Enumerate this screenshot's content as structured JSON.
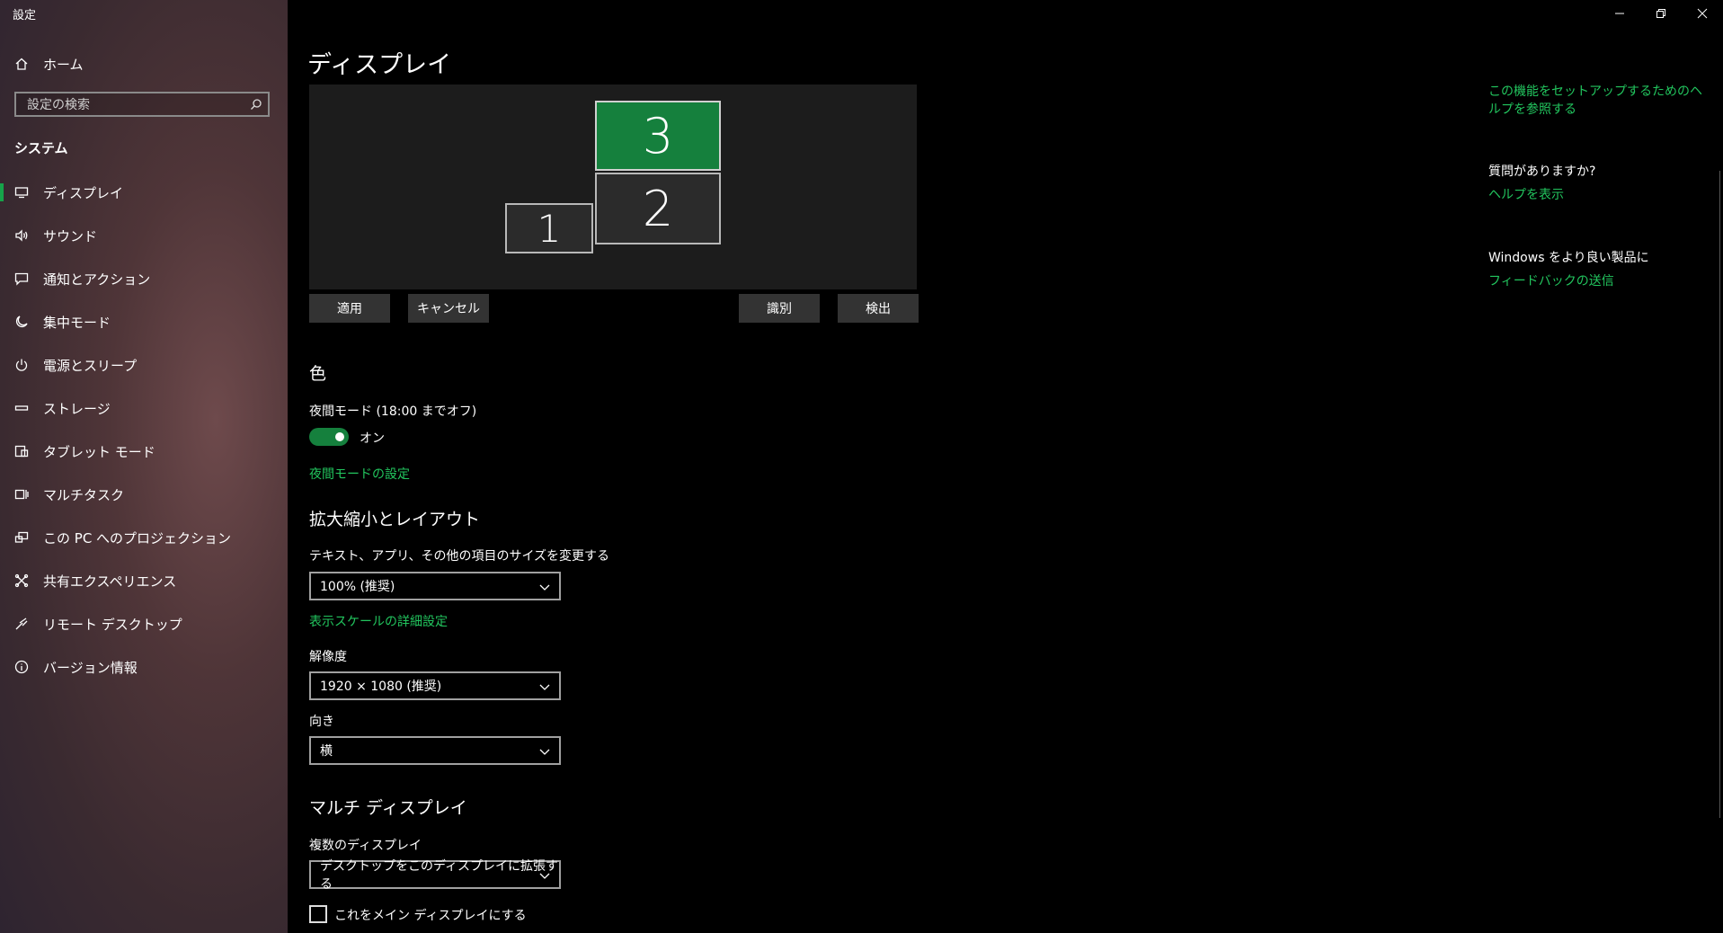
{
  "window": {
    "title": "設定"
  },
  "sidebar": {
    "home_label": "ホーム",
    "search_placeholder": "設定の検索",
    "section_heading": "システム",
    "items": [
      {
        "label": "ディスプレイ",
        "icon": "display-icon",
        "selected": true
      },
      {
        "label": "サウンド",
        "icon": "speaker-icon"
      },
      {
        "label": "通知とアクション",
        "icon": "notification-icon"
      },
      {
        "label": "集中モード",
        "icon": "moon-icon"
      },
      {
        "label": "電源とスリープ",
        "icon": "power-icon"
      },
      {
        "label": "ストレージ",
        "icon": "storage-icon"
      },
      {
        "label": "タブレット モード",
        "icon": "tablet-icon"
      },
      {
        "label": "マルチタスク",
        "icon": "multitask-icon"
      },
      {
        "label": "この PC へのプロジェクション",
        "icon": "projection-icon"
      },
      {
        "label": "共有エクスペリエンス",
        "icon": "share-icon"
      },
      {
        "label": "リモート デスクトップ",
        "icon": "remote-icon"
      },
      {
        "label": "バージョン情報",
        "icon": "info-icon"
      }
    ]
  },
  "main": {
    "title": "ディスプレイ",
    "monitors": [
      {
        "number": "1"
      },
      {
        "number": "2"
      },
      {
        "number": "3",
        "active": true
      }
    ],
    "buttons": {
      "apply": "適用",
      "cancel": "キャンセル",
      "identify": "識別",
      "detect": "検出"
    },
    "color": {
      "heading": "色",
      "night_mode_label": "夜間モード (18:00 までオフ)",
      "toggle_state": "オン",
      "night_settings_link": "夜間モードの設定"
    },
    "scale": {
      "heading": "拡大縮小とレイアウト",
      "size_label": "テキスト、アプリ、その他の項目のサイズを変更する",
      "size_value": "100% (推奨)",
      "advanced_link": "表示スケールの詳細設定",
      "resolution_label": "解像度",
      "resolution_value": "1920 × 1080 (推奨)",
      "orientation_label": "向き",
      "orientation_value": "横"
    },
    "multi": {
      "heading": "マルチ ディスプレイ",
      "multi_label": "複数のディスプレイ",
      "multi_value": "デスクトップをこのディスプレイに拡張する",
      "main_checkbox_label": "これをメイン ディスプレイにする"
    }
  },
  "help": {
    "setup_link": "この機能をセットアップするためのヘルプを参照する",
    "question_heading": "質問がありますか?",
    "help_link": "ヘルプを表示",
    "feedback_heading": "Windows をより良い製品に",
    "feedback_link": "フィードバックの送信"
  },
  "colors": {
    "accent": "#22c55e",
    "accent_dark": "#15803d",
    "background": "#000000"
  }
}
